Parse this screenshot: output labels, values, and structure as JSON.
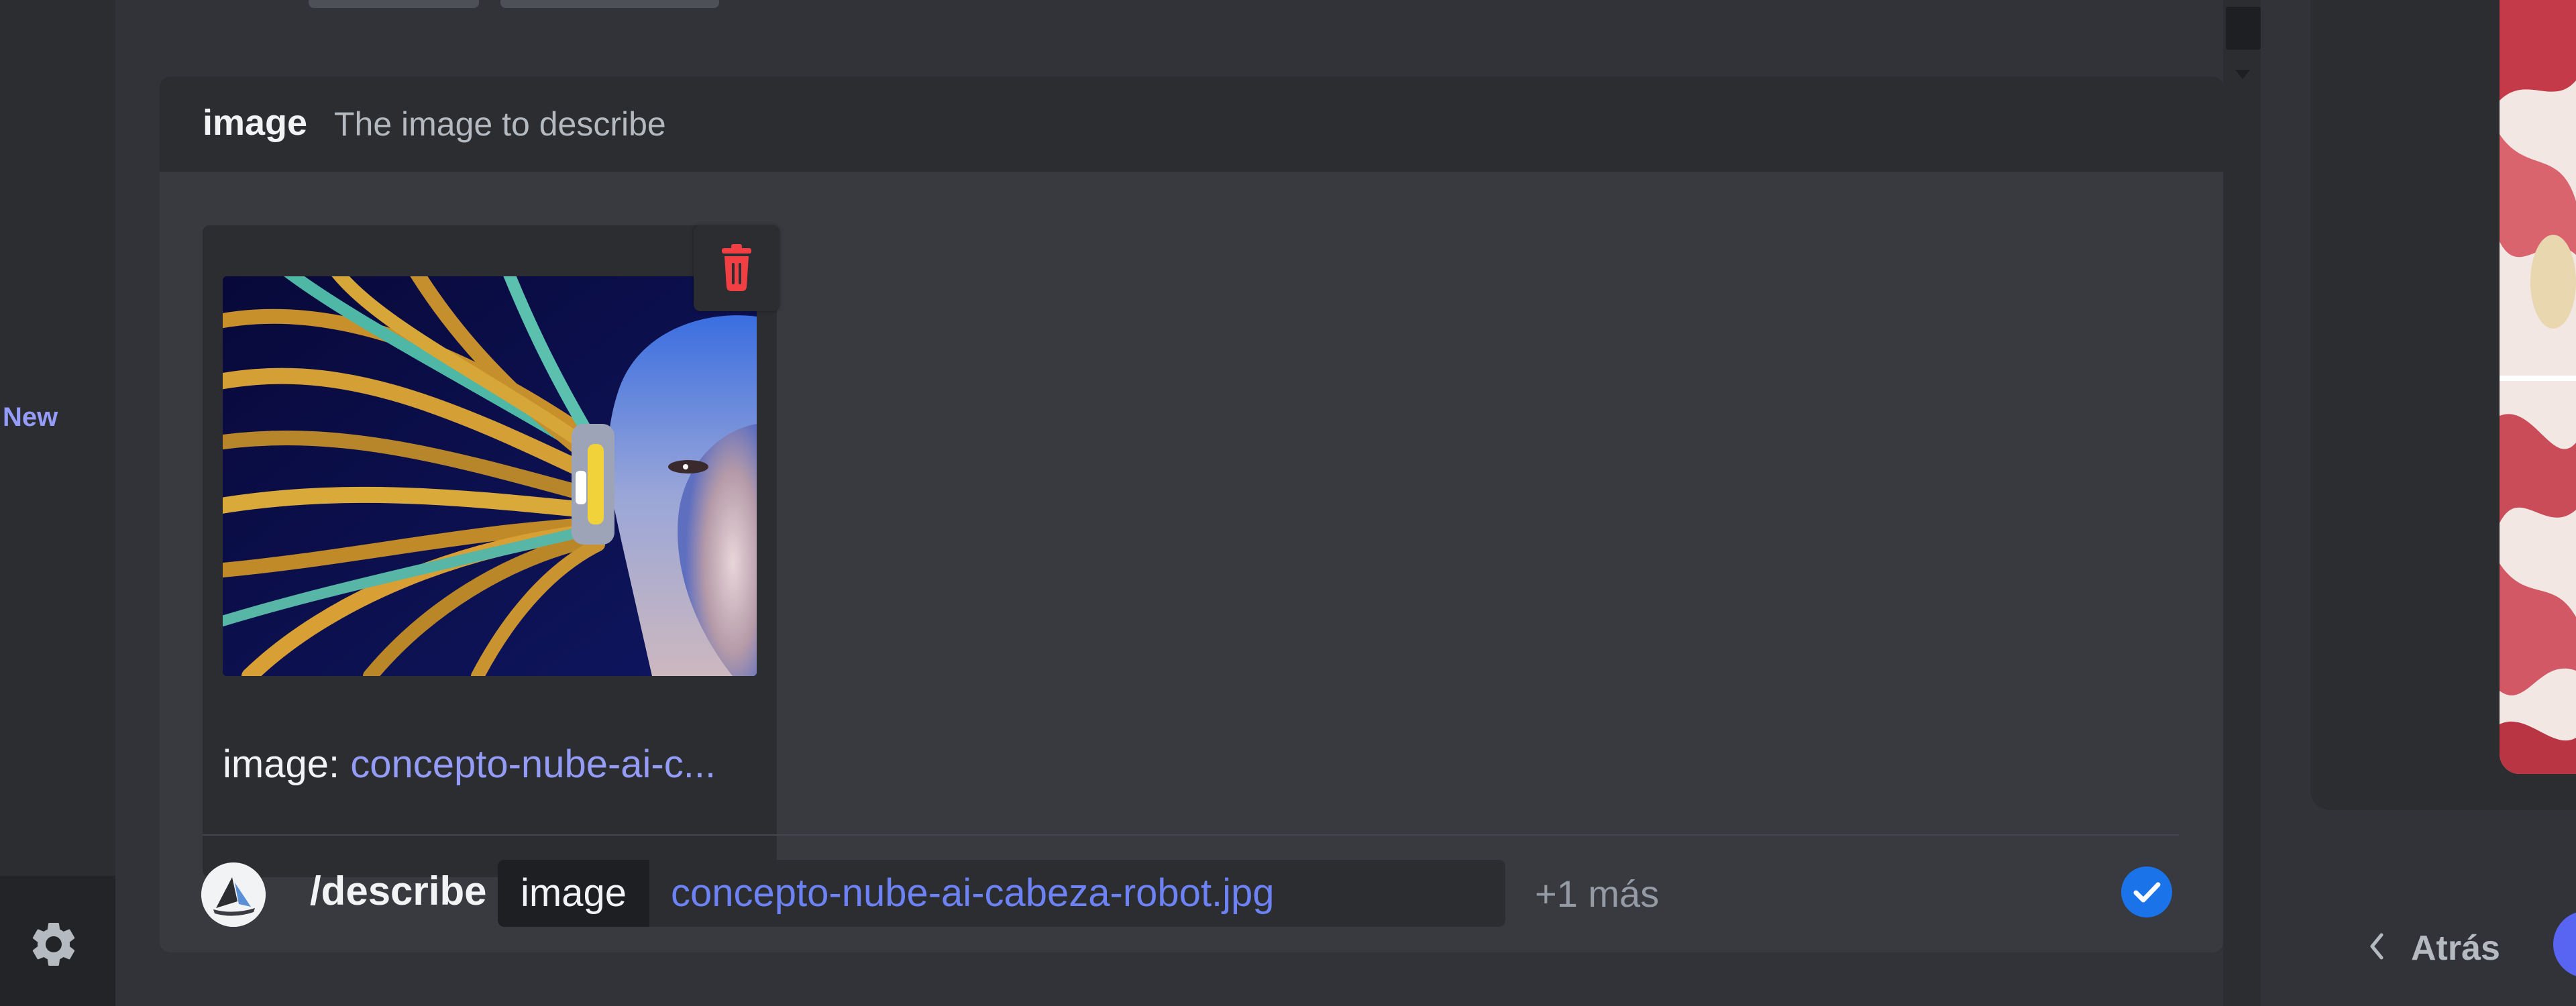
{
  "sidebar": {
    "new_label": "New"
  },
  "option": {
    "name": "image",
    "description": "The image to describe"
  },
  "upload": {
    "caption_label": "image:",
    "caption_file": "concepto-nube-ai-c..."
  },
  "command": {
    "name": "/describe",
    "chip_label": "image",
    "chip_value": "concepto-nube-ai-cabeza-robot.jpg",
    "more": "+1 más"
  },
  "nav": {
    "back_label": "Atrás"
  },
  "icons": {
    "settings": "gear-icon",
    "delete": "trash-icon",
    "confirm": "check-circle-icon",
    "back": "chevron-left-icon"
  },
  "colors": {
    "accent": "#5865f2",
    "link": "#949cf7",
    "danger": "#f23f43",
    "confirm": "#1a73e8"
  }
}
